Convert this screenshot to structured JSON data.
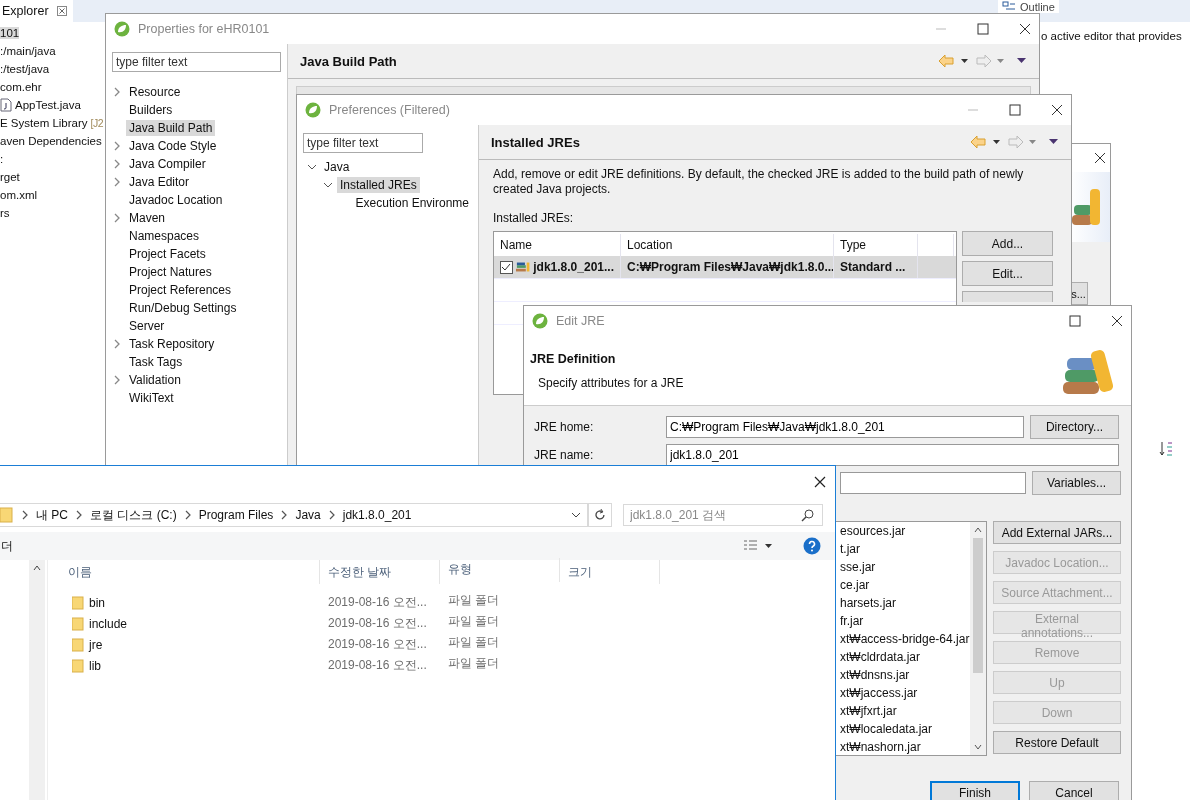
{
  "ide": {
    "explorer_tab": "Explorer",
    "tree": [
      {
        "label": "101",
        "selected": true,
        "kind": "text"
      },
      {
        "label": ":/main/java",
        "selected": false,
        "kind": "text"
      },
      {
        "label": ":/test/java",
        "selected": false,
        "kind": "text"
      },
      {
        "label": "com.ehr",
        "selected": false,
        "kind": "text"
      },
      {
        "label": "AppTest.java",
        "selected": false,
        "kind": "java"
      },
      {
        "label": "E System Library",
        "suffix": "[J2",
        "selected": false,
        "kind": "text"
      },
      {
        "label": "aven Dependencies",
        "selected": false,
        "kind": "text"
      },
      {
        "label": ":",
        "selected": false,
        "kind": "text"
      },
      {
        "label": "rget",
        "selected": false,
        "kind": "text"
      },
      {
        "label": "om.xml",
        "selected": false,
        "kind": "text"
      },
      {
        "label": "rs",
        "selected": false,
        "kind": "text"
      }
    ],
    "outline_tab": "Outline",
    "outline_message": "o active editor that provides"
  },
  "properties": {
    "title": "Properties for eHR0101",
    "filter_placeholder": "type filter text",
    "page_title": "Java Build Path",
    "items": [
      {
        "label": "Resource",
        "expandable": true,
        "selected": false
      },
      {
        "label": "Builders",
        "expandable": false,
        "selected": false
      },
      {
        "label": "Java Build Path",
        "expandable": false,
        "selected": true
      },
      {
        "label": "Java Code Style",
        "expandable": true,
        "selected": false
      },
      {
        "label": "Java Compiler",
        "expandable": true,
        "selected": false
      },
      {
        "label": "Java Editor",
        "expandable": true,
        "selected": false
      },
      {
        "label": "Javadoc Location",
        "expandable": false,
        "selected": false
      },
      {
        "label": "Maven",
        "expandable": true,
        "selected": false
      },
      {
        "label": "Namespaces",
        "expandable": false,
        "selected": false
      },
      {
        "label": "Project Facets",
        "expandable": false,
        "selected": false
      },
      {
        "label": "Project Natures",
        "expandable": false,
        "selected": false
      },
      {
        "label": "Project References",
        "expandable": false,
        "selected": false
      },
      {
        "label": "Run/Debug Settings",
        "expandable": false,
        "selected": false
      },
      {
        "label": "Server",
        "expandable": false,
        "selected": false
      },
      {
        "label": "Task Repository",
        "expandable": true,
        "selected": false
      },
      {
        "label": "Task Tags",
        "expandable": false,
        "selected": false
      },
      {
        "label": "Validation",
        "expandable": true,
        "selected": false
      },
      {
        "label": "WikiText",
        "expandable": false,
        "selected": false
      }
    ]
  },
  "preferences": {
    "title": "Preferences (Filtered)",
    "filter_placeholder": "type filter text",
    "tree": [
      {
        "label": "Java",
        "expanded": true,
        "selected": false,
        "children": [
          {
            "label": "Installed JREs",
            "expanded": true,
            "selected": true,
            "children": [
              {
                "label": "Execution Environme",
                "selected": false
              }
            ]
          }
        ]
      }
    ],
    "page_title": "Installed JREs",
    "description": "Add, remove or edit JRE definitions. By default, the checked JRE is added to the build path of newly created Java projects.",
    "table_label": "Installed JREs:",
    "columns": [
      "Name",
      "Location",
      "Type"
    ],
    "rows": [
      {
        "checked": true,
        "selected": true,
        "name": "jdk1.8.0_201...",
        "location": "C:₩Program Files₩Java₩jdk1.8.0...",
        "type": "Standard ..."
      }
    ],
    "buttons": [
      "Add...",
      "Edit..."
    ]
  },
  "hidden_dialog": {
    "button": "s..."
  },
  "edit_jre": {
    "title": "Edit JRE",
    "heading": "JRE Definition",
    "subheading": "Specify attributes for a JRE",
    "fields": [
      {
        "label": "JRE home:",
        "value": "C:₩Program Files₩Java₩jdk1.8.0_201",
        "button": "Directory..."
      },
      {
        "label": "JRE name:",
        "value": "jdk1.8.0_201"
      },
      {
        "button": "Variables..."
      }
    ],
    "libraries": [
      "esources.jar",
      "t.jar",
      "sse.jar",
      "ce.jar",
      "harsets.jar",
      "fr.jar",
      "xt₩access-bridge-64.jar",
      "xt₩cldrdata.jar",
      "xt₩dnsns.jar",
      "xt₩jaccess.jar",
      "xt₩jfxrt.jar",
      "xt₩localedata.jar",
      "xt₩nashorn.jar"
    ],
    "library_buttons": [
      {
        "label": "Add External JARs...",
        "disabled": false
      },
      {
        "label": "Javadoc Location...",
        "disabled": true
      },
      {
        "label": "Source Attachment...",
        "disabled": true
      },
      {
        "label": "External annotations...",
        "disabled": true
      },
      {
        "label": "Remove",
        "disabled": true
      },
      {
        "label": "Up",
        "disabled": true
      },
      {
        "label": "Down",
        "disabled": true
      },
      {
        "label": "Restore Default",
        "disabled": false
      }
    ],
    "footer_buttons": [
      {
        "label": "Finish",
        "default": true
      },
      {
        "label": "Cancel",
        "default": false
      }
    ]
  },
  "file_explorer": {
    "breadcrumb": [
      "내 PC",
      "로컬 디스크 (C:)",
      "Program Files",
      "Java",
      "jdk1.8.0_201"
    ],
    "search_placeholder": "jdk1.8.0_201 검색",
    "ribbon_label": "더",
    "columns": [
      "이름",
      "수정한 날짜",
      "유형",
      "크기"
    ],
    "rows": [
      {
        "name": "bin",
        "modified": "2019-08-16 오전...",
        "type": "파일 폴더"
      },
      {
        "name": "include",
        "modified": "2019-08-16 오전...",
        "type": "파일 폴더"
      },
      {
        "name": "jre",
        "modified": "2019-08-16 오전...",
        "type": "파일 폴더"
      },
      {
        "name": "lib",
        "modified": "2019-08-16 오전...",
        "type": "파일 폴더"
      }
    ]
  }
}
